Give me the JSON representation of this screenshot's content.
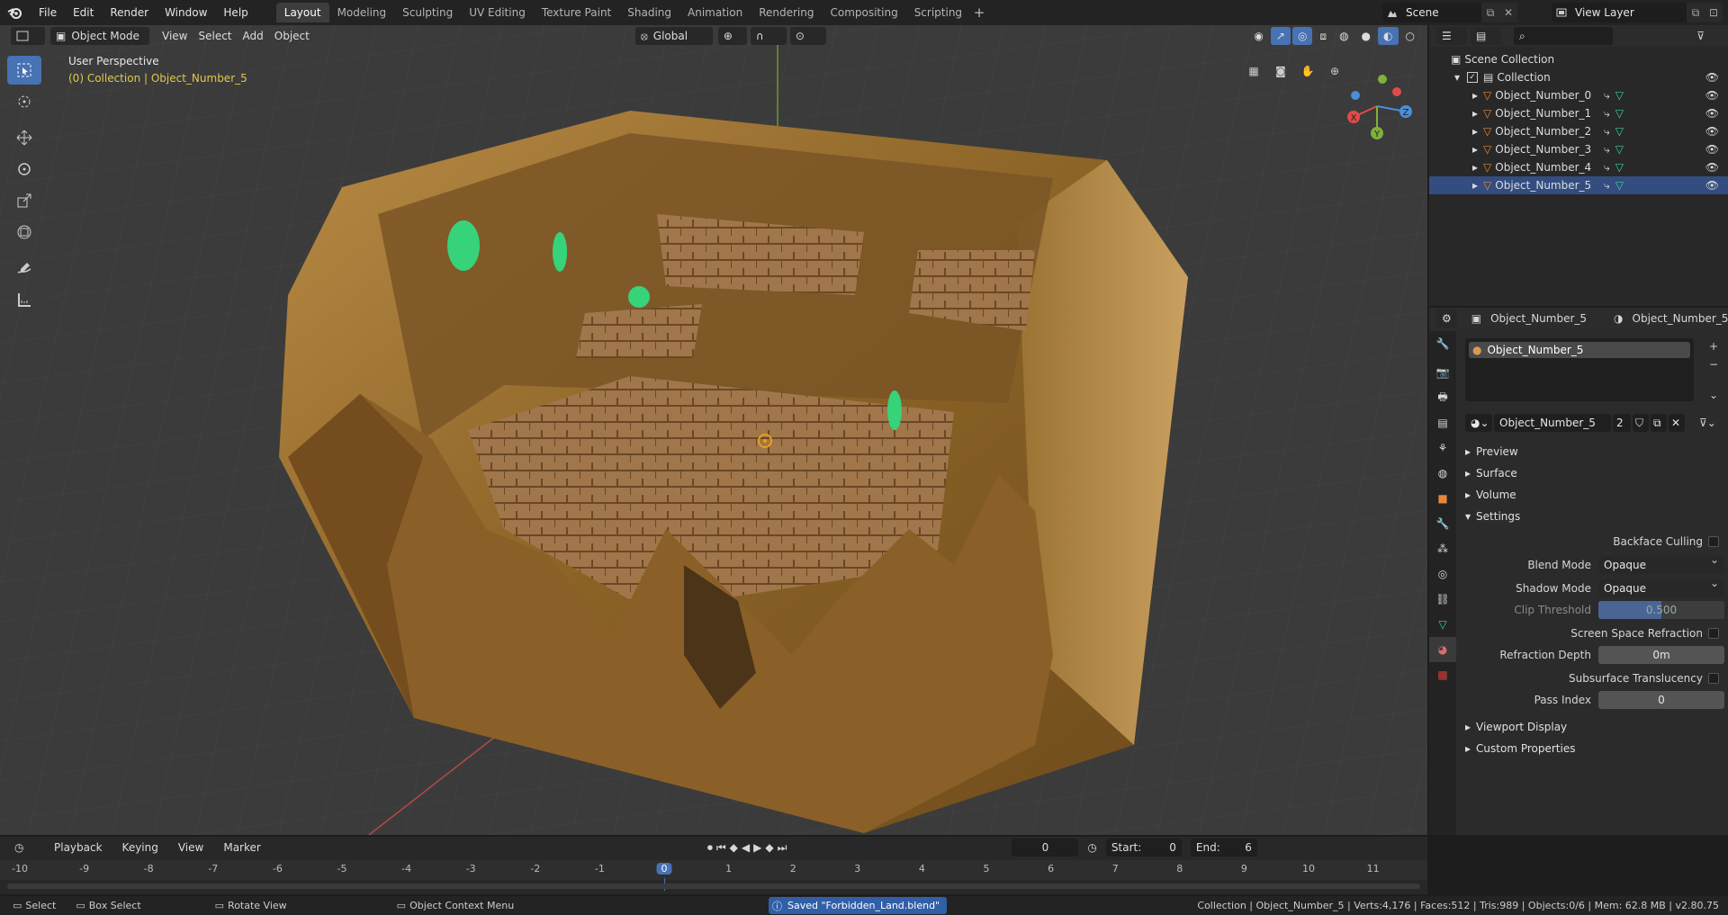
{
  "app": {
    "menus": [
      "File",
      "Edit",
      "Render",
      "Window",
      "Help"
    ],
    "workspaces": [
      "Layout",
      "Modeling",
      "Sculpting",
      "UV Editing",
      "Texture Paint",
      "Shading",
      "Animation",
      "Rendering",
      "Compositing",
      "Scripting"
    ],
    "active_workspace": "Layout",
    "scene_name": "Scene",
    "view_layer_name": "View Layer"
  },
  "viewport": {
    "mode": "Object Mode",
    "menus": [
      "View",
      "Select",
      "Add",
      "Object"
    ],
    "transform_orientation": "Global",
    "perspective_label": "User Perspective",
    "context_label": "(0) Collection | Object_Number_5",
    "axis_x": "X",
    "axis_y": "Y",
    "axis_z": "Z",
    "icons": {
      "accent": "#4772b3",
      "axis_x_color": "#e04a4a",
      "axis_y_color": "#7fb13b",
      "axis_z_color": "#4a8fd6"
    }
  },
  "outliner": {
    "root": "Scene Collection",
    "collection": "Collection",
    "objects": [
      {
        "name": "Object_Number_0",
        "selected": false
      },
      {
        "name": "Object_Number_1",
        "selected": false
      },
      {
        "name": "Object_Number_2",
        "selected": false
      },
      {
        "name": "Object_Number_3",
        "selected": false
      },
      {
        "name": "Object_Number_4",
        "selected": false
      },
      {
        "name": "Object_Number_5",
        "selected": true
      }
    ]
  },
  "properties": {
    "object_name": "Object_Number_5",
    "material_name": "Object_Number_5",
    "slot_name": "Object_Number_5",
    "material_field": "Object_Number_5",
    "user_count": "2",
    "panels": {
      "preview": "Preview",
      "surface": "Surface",
      "volume": "Volume",
      "settings": "Settings",
      "viewport_display": "Viewport Display",
      "custom_properties": "Custom Properties"
    },
    "settings": {
      "backface_culling_label": "Backface Culling",
      "blend_mode_label": "Blend Mode",
      "blend_mode_value": "Opaque",
      "shadow_mode_label": "Shadow Mode",
      "shadow_mode_value": "Opaque",
      "clip_threshold_label": "Clip Threshold",
      "clip_threshold_value": "0.500",
      "ssr_label": "Screen Space Refraction",
      "refraction_depth_label": "Refraction Depth",
      "refraction_depth_value": "0m",
      "sss_label": "Subsurface Translucency",
      "pass_index_label": "Pass Index",
      "pass_index_value": "0"
    }
  },
  "timeline": {
    "menus": [
      "Playback",
      "Keying",
      "View",
      "Marker"
    ],
    "current_frame": "0",
    "start_label": "Start:",
    "start_value": "0",
    "end_label": "End:",
    "end_value": "6",
    "ticks": [
      "-10",
      "-9",
      "-8",
      "-7",
      "-6",
      "-5",
      "-4",
      "-3",
      "-2",
      "-1",
      "0",
      "1",
      "2",
      "3",
      "4",
      "5",
      "6",
      "7",
      "8",
      "9",
      "10",
      "11"
    ]
  },
  "statusbar": {
    "select": "Select",
    "box_select": "Box Select",
    "rotate_view": "Rotate View",
    "context_menu": "Object Context Menu",
    "saved_message": "Saved \"Forbidden_Land.blend\"",
    "stats": "Collection | Object_Number_5 | Verts:4,176 | Faces:512 | Tris:989 | Objects:0/6 | Mem: 62.8 MB | v2.80.75"
  }
}
